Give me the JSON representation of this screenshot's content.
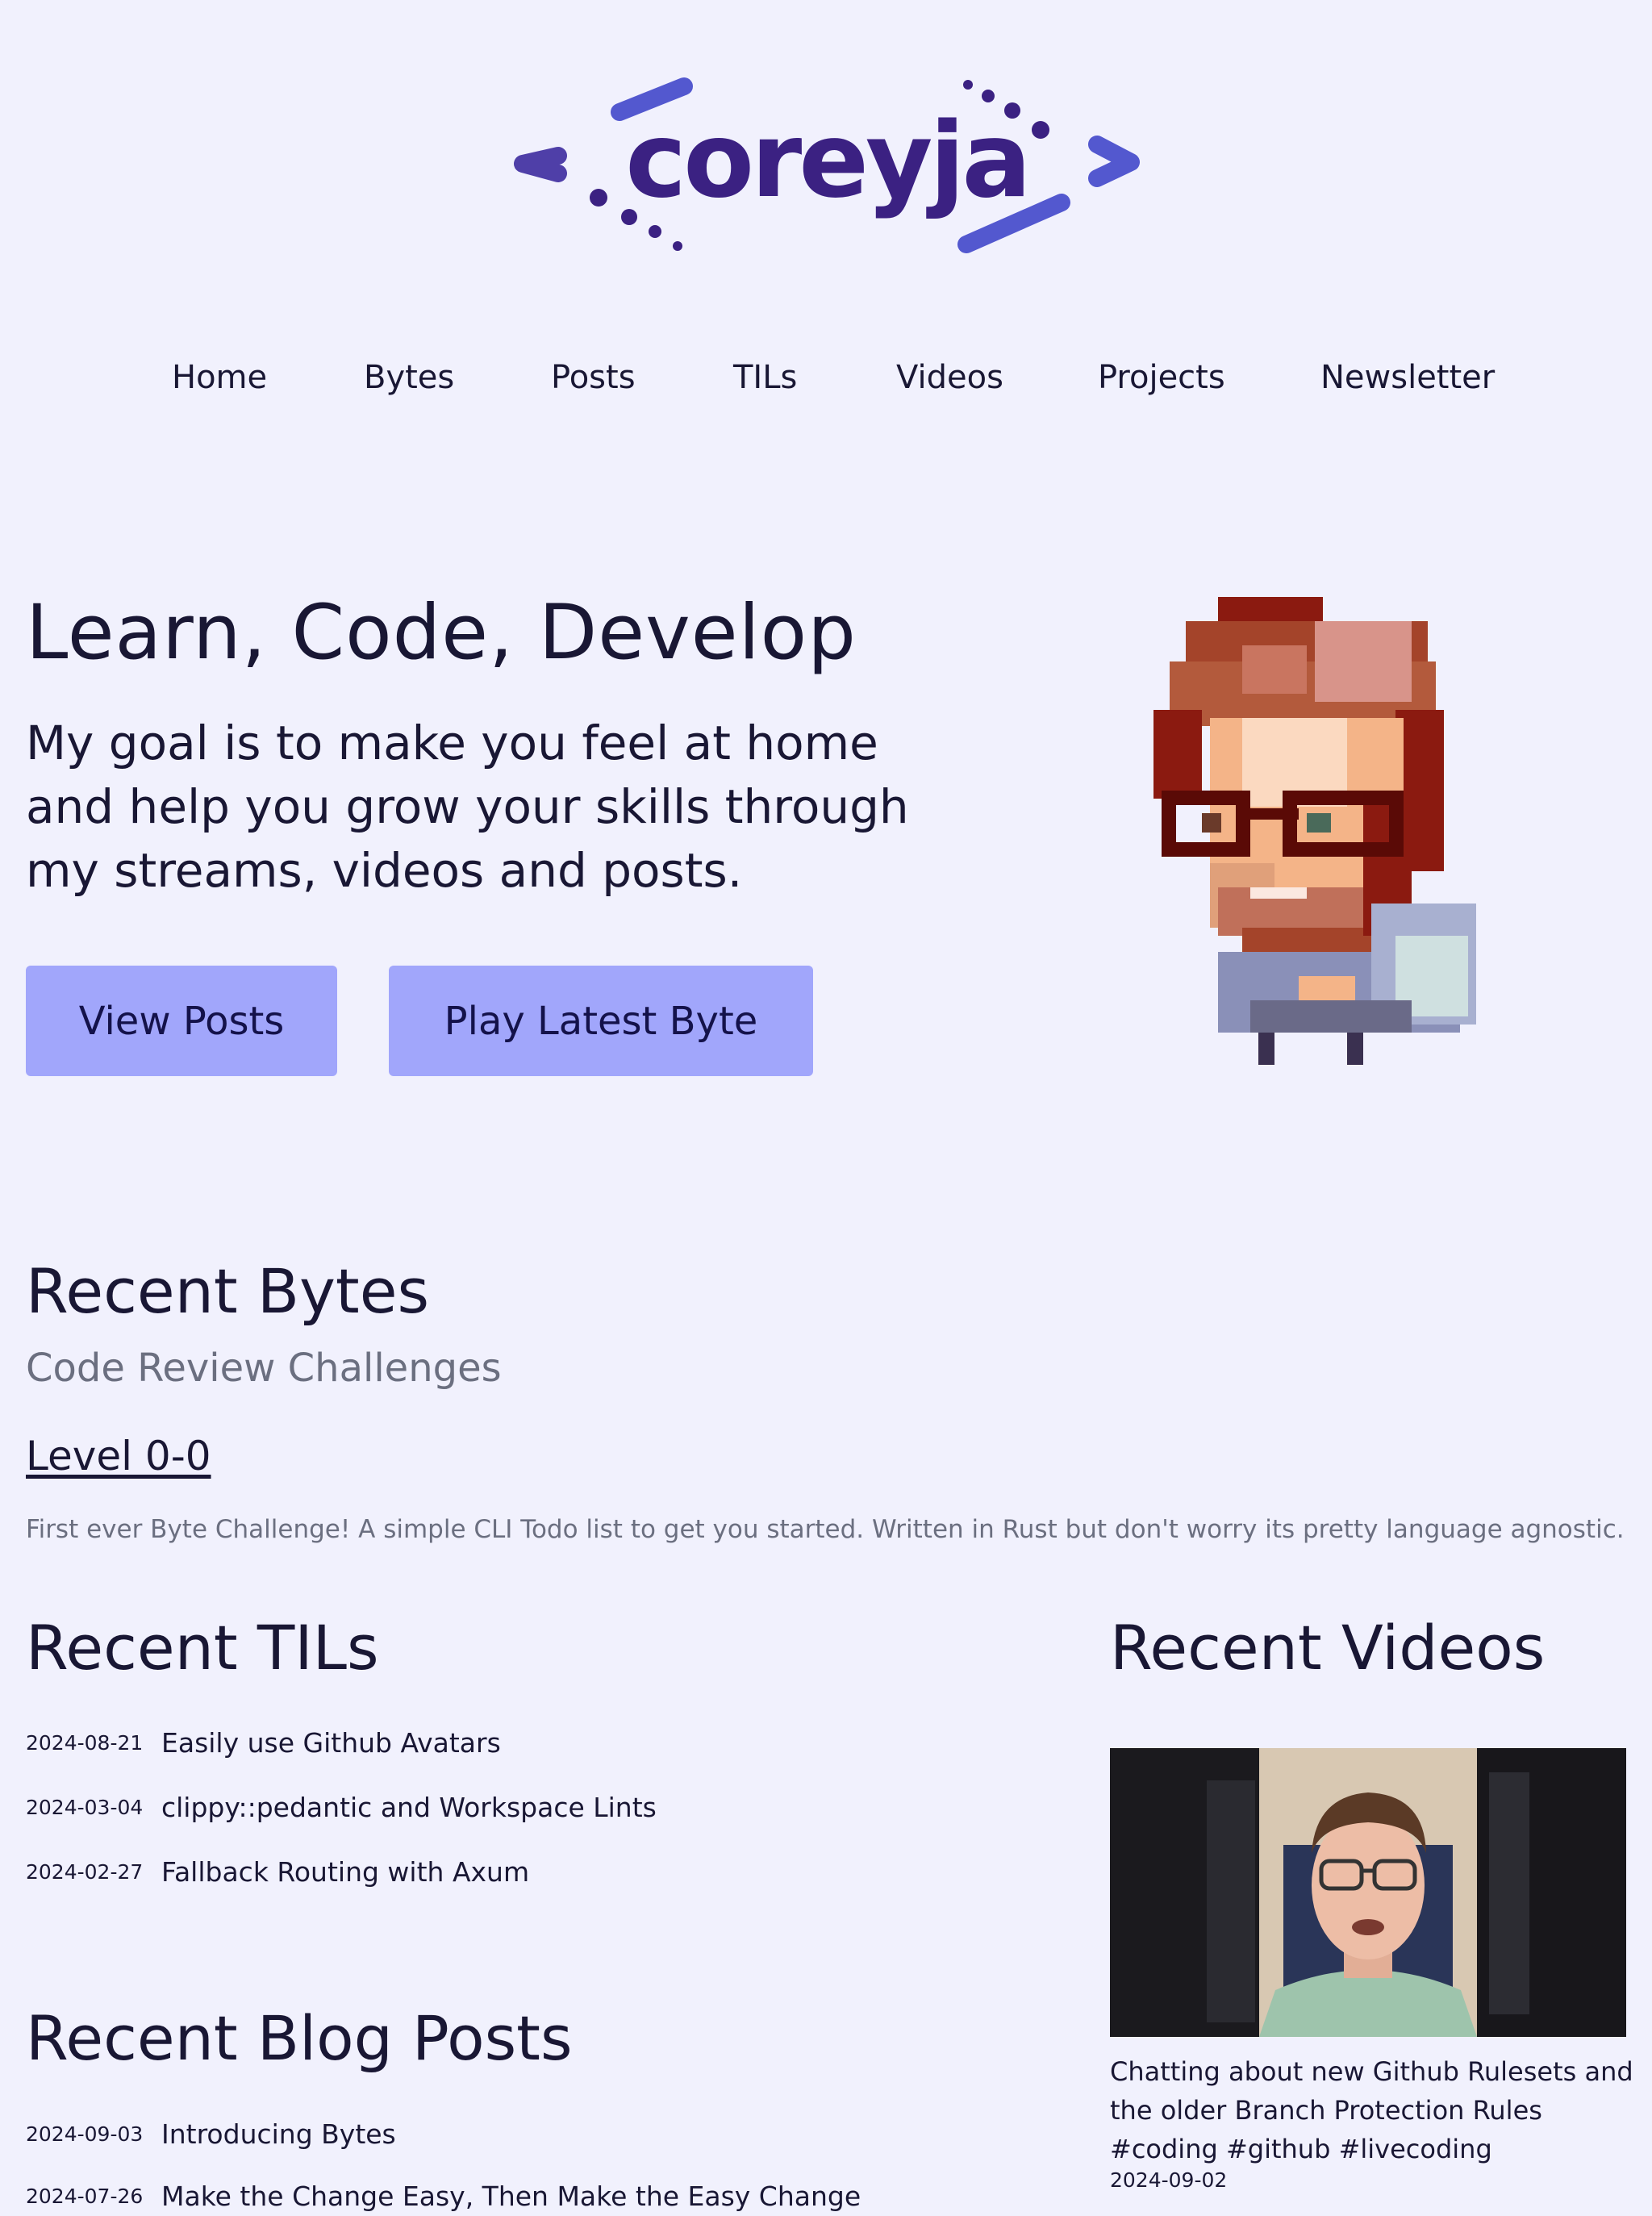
{
  "logo": {
    "text": "coreyja",
    "primary_color": "#5358cf",
    "dark_color": "#3b2182"
  },
  "nav": {
    "items": [
      {
        "label": "Home"
      },
      {
        "label": "Bytes"
      },
      {
        "label": "Posts"
      },
      {
        "label": "TILs"
      },
      {
        "label": "Videos"
      },
      {
        "label": "Projects"
      },
      {
        "label": "Newsletter"
      }
    ]
  },
  "hero": {
    "title": "Learn, Code, Develop",
    "subtitle": "My goal is to make you feel at home and help you grow your skills through my streams, videos and posts.",
    "buttons": {
      "view_posts": "View Posts",
      "play_latest_byte": "Play Latest Byte"
    },
    "button_color": "#a1a6fb"
  },
  "recent_bytes": {
    "heading": "Recent Bytes",
    "category": "Code Review Challenges",
    "item": {
      "title": "Level 0-0",
      "description": "First ever Byte Challenge! A simple CLI Todo list to get you started. Written in Rust but don't worry its pretty language agnostic."
    }
  },
  "recent_tils": {
    "heading": "Recent TILs",
    "items": [
      {
        "date": "2024-08-21",
        "title": "Easily use Github Avatars"
      },
      {
        "date": "2024-03-04",
        "title": "clippy::pedantic and Workspace Lints"
      },
      {
        "date": "2024-02-27",
        "title": "Fallback Routing with Axum"
      }
    ]
  },
  "recent_posts": {
    "heading": "Recent Blog Posts",
    "items": [
      {
        "date": "2024-09-03",
        "title": "Introducing Bytes"
      },
      {
        "date": "2024-07-26",
        "title": "Make the Change Easy, Then Make the Easy Change"
      }
    ]
  },
  "recent_videos": {
    "heading": "Recent Videos",
    "items": [
      {
        "title": "Chatting about new Github Rulesets and the older Branch Protection Rules #coding #github #livecoding",
        "date": "2024-09-02"
      }
    ]
  }
}
